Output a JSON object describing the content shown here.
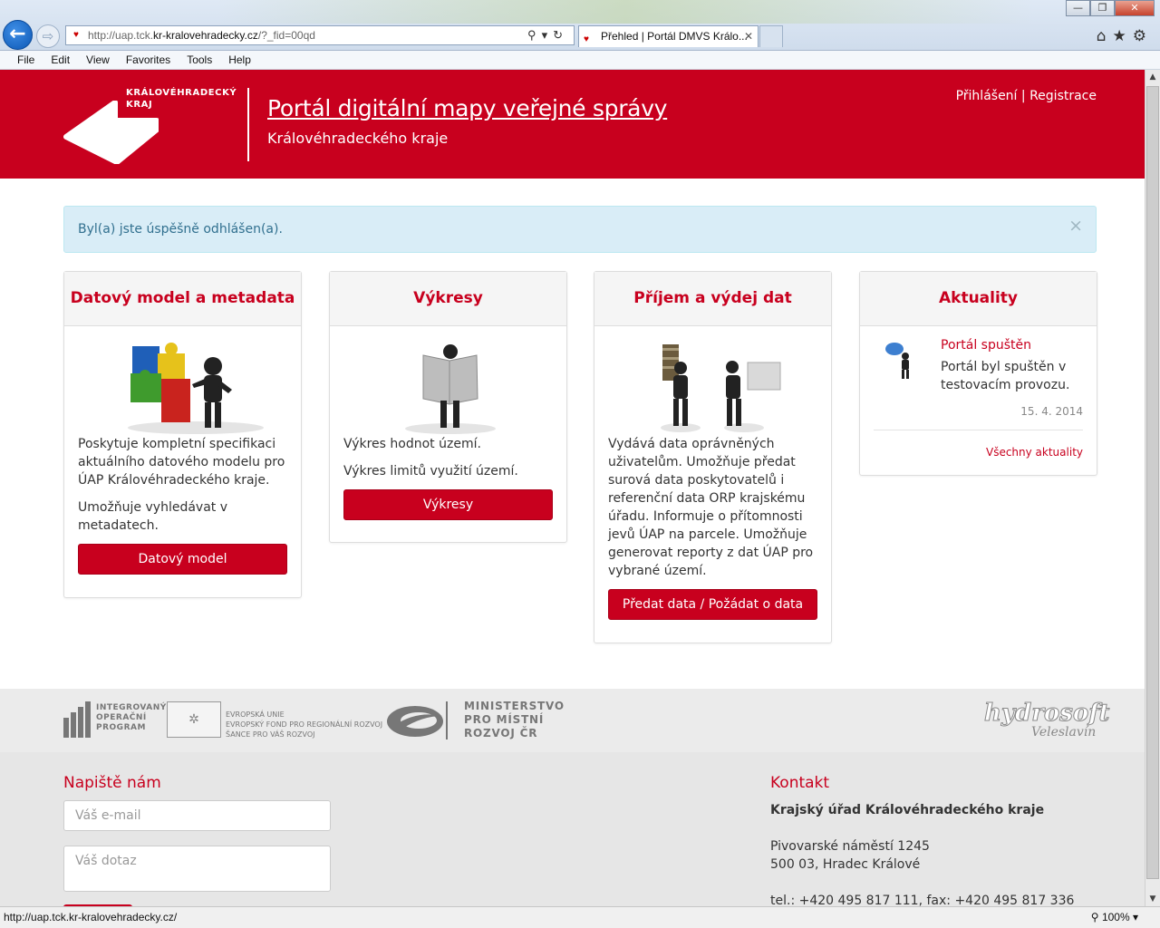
{
  "browser": {
    "url_prefix": "http://uap.tck.",
    "url_domain": "kr-kralovehradecky.cz",
    "url_suffix": "/?_fid=00qd",
    "tab_title": "Přehled | Portál DMVS Královéhradeckého kraje",
    "tab_title_visible": "Přehled | Portál DMVS Králo...",
    "menu": [
      "File",
      "Edit",
      "View",
      "Favorites",
      "Tools",
      "Help"
    ],
    "status_url": "http://uap.tck.kr-kralovehradecky.cz/",
    "zoom": "100%"
  },
  "header": {
    "logo_line1": "KRÁLOVÉHRADECKÝ",
    "logo_line2": "KRAJ",
    "title": "Portál digitální mapy veřejné správy",
    "subtitle": "Královéhradeckého kraje",
    "login": "Přihlášení",
    "separator": "|",
    "register": "Registrace"
  },
  "alert": {
    "message": "Byl(a) jste úspěšně odhlášen(a).",
    "close": "×"
  },
  "cards": [
    {
      "title": "Datový model a metadata",
      "paragraphs": [
        "Poskytuje kompletní specifikaci aktuálního datového modelu pro ÚAP Královéhradeckého kraje.",
        "Umožňuje vyhledávat v metadatech."
      ],
      "button": "Datový model"
    },
    {
      "title": "Výkresy",
      "paragraphs": [
        "Výkres hodnot území.",
        "Výkres limitů využití území."
      ],
      "button": "Výkresy"
    },
    {
      "title": "Příjem a výdej dat",
      "paragraphs": [
        "Vydává data oprávněných uživatelům. Umožňuje předat surová data poskytovatelů i referenční data ORP krajskému úřadu. Informuje o přítomnosti jevů ÚAP na parcele. Umožňuje generovat reporty z dat ÚAP pro vybrané území."
      ],
      "button": "Předat data / Požádat o data"
    },
    {
      "title": "Aktuality",
      "news_title": "Portál spuštěn",
      "news_text": "Portál byl spuštěn v testovacím provozu.",
      "news_date": "15. 4. 2014",
      "all_news": "Všechny aktuality"
    }
  ],
  "logos": {
    "iop_1": "INTEGROVANÝ",
    "iop_2": "OPERAČNÍ",
    "iop_3": "PROGRAM",
    "eu_1": "EVROPSKÁ UNIE",
    "eu_2": "EVROPSKÝ FOND PRO REGIONÁLNÍ ROZVOJ",
    "eu_3": "ŠANCE PRO VÁŠ ROZVOJ",
    "mmr_1": "MINISTERSTVO",
    "mmr_2": "PRO MÍSTNÍ",
    "mmr_3": "ROZVOJ ČR",
    "hydrosoft": "hydrosoft",
    "hydrosoft_sub": "Veleslavín"
  },
  "footer": {
    "write_heading": "Napiště nám",
    "email_placeholder": "Váš e-mail",
    "question_placeholder": "Váš dotaz",
    "contact_heading": "Kontakt",
    "org": "Krajský úřad Královéhradeckého kraje",
    "street": "Pivovarské náměstí 1245",
    "city": "500 03, Hradec Králové",
    "phone": "tel.: +420 495 817 111, fax: +420 495 817 336"
  },
  "colors": {
    "brand_red": "#c8001e",
    "alert_bg": "#d9edf7",
    "alert_text": "#31708f"
  }
}
